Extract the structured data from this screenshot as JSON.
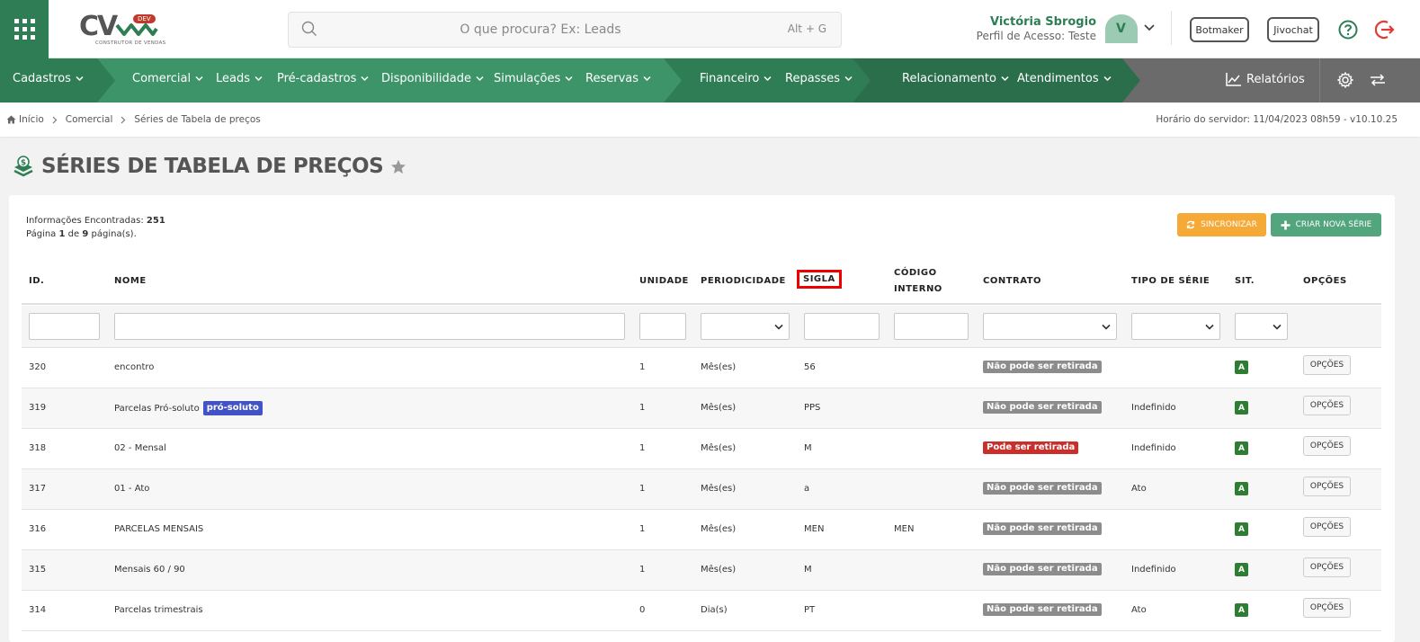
{
  "header": {
    "logo": {
      "text": "CV",
      "badge": "DEV",
      "subtitle": "CONSTRUTOR DE VENDAS"
    },
    "search": {
      "placeholder": "O que procura? Ex: Leads",
      "shortcut": "Alt + G"
    },
    "user": {
      "name": "Victória Sbrogio",
      "profile": "Perfil de Acesso: Teste",
      "avatar_initial": "V"
    },
    "buttons": {
      "botmaker": "Botmaker",
      "jivochat": "Jivochat"
    }
  },
  "nav": {
    "items": [
      {
        "label": "Cadastros"
      },
      {
        "label": "Comercial"
      },
      {
        "label": "Leads"
      },
      {
        "label": "Pré-cadastros"
      },
      {
        "label": "Disponibilidade"
      },
      {
        "label": "Simulações"
      },
      {
        "label": "Reservas"
      },
      {
        "label": "Financeiro"
      },
      {
        "label": "Repasses"
      },
      {
        "label": "Relacionamento"
      },
      {
        "label": "Atendimentos"
      }
    ],
    "reports": "Relatórios"
  },
  "breadcrumb": {
    "items": [
      "Início",
      "Comercial",
      "Séries de Tabela de preços"
    ],
    "server_time": "Horário do servidor: 11/04/2023 08h59 - v10.10.25"
  },
  "page": {
    "title": "SÉRIES DE TABELA DE PREÇOS",
    "info_label": "Informações Encontradas:",
    "info_count": "251",
    "page_prefix": "Página",
    "page_current": "1",
    "page_of": "de",
    "page_total": "9",
    "page_suffix": "página(s).",
    "sync_label": "SINCRONIZAR",
    "new_label": "CRIAR NOVA SÉRIE"
  },
  "table": {
    "headers": {
      "id": "ID.",
      "nome": "NOME",
      "unidade": "UNIDADE",
      "periodicidade": "PERIODICIDADE",
      "sigla": "SIGLA",
      "codigo_1": "CÓDIGO",
      "codigo_2": "INTERNO",
      "contrato": "CONTRATO",
      "tipo": "TIPO DE SÉRIE",
      "sit": "SIT.",
      "opcoes": "OPÇÕES"
    },
    "rows": [
      {
        "id": "320",
        "nome": "encontro",
        "tag": "",
        "unidade": "1",
        "periodicidade": "Mês(es)",
        "sigla": "56",
        "codigo": "",
        "contrato": "Não pode ser retirada",
        "contrato_type": "grey",
        "tipo": "",
        "sit": "A",
        "opcoes": "OPÇÕES"
      },
      {
        "id": "319",
        "nome": "Parcelas Pró-soluto",
        "tag": "pró-soluto",
        "unidade": "1",
        "periodicidade": "Mês(es)",
        "sigla": "PPS",
        "codigo": "",
        "contrato": "Não pode ser retirada",
        "contrato_type": "grey",
        "tipo": "Indefinido",
        "sit": "A",
        "opcoes": "OPÇÕES"
      },
      {
        "id": "318",
        "nome": "02 - Mensal",
        "tag": "",
        "unidade": "1",
        "periodicidade": "Mês(es)",
        "sigla": "M",
        "codigo": "",
        "contrato": "Pode ser retirada",
        "contrato_type": "red",
        "tipo": "Indefinido",
        "sit": "A",
        "opcoes": "OPÇÕES"
      },
      {
        "id": "317",
        "nome": "01 - Ato",
        "tag": "",
        "unidade": "1",
        "periodicidade": "Mês(es)",
        "sigla": "a",
        "codigo": "",
        "contrato": "Não pode ser retirada",
        "contrato_type": "grey",
        "tipo": "Ato",
        "sit": "A",
        "opcoes": "OPÇÕES"
      },
      {
        "id": "316",
        "nome": "PARCELAS MENSAIS",
        "tag": "",
        "unidade": "1",
        "periodicidade": "Mês(es)",
        "sigla": "MEN",
        "codigo": "MEN",
        "contrato": "Não pode ser retirada",
        "contrato_type": "grey",
        "tipo": "",
        "sit": "A",
        "opcoes": "OPÇÕES"
      },
      {
        "id": "315",
        "nome": "Mensais 60 / 90",
        "tag": "",
        "unidade": "1",
        "periodicidade": "Mês(es)",
        "sigla": "M",
        "codigo": "",
        "contrato": "Não pode ser retirada",
        "contrato_type": "grey",
        "tipo": "Indefinido",
        "sit": "A",
        "opcoes": "OPÇÕES"
      },
      {
        "id": "314",
        "nome": "Parcelas trimestrais",
        "tag": "",
        "unidade": "0",
        "periodicidade": "Dia(s)",
        "sigla": "PT",
        "codigo": "",
        "contrato": "Não pode ser retirada",
        "contrato_type": "grey",
        "tipo": "Ato",
        "sit": "A",
        "opcoes": "OPÇÕES"
      }
    ]
  },
  "colors": {
    "brand_green": "#2e7d54",
    "nav_green": "#3d9468",
    "sync_orange": "#f5a936",
    "new_green": "#52a57c",
    "badge_red": "#c9302c",
    "badge_grey": "#8c8c8c",
    "tag_blue": "#4254c5",
    "highlight_red": "#e00000"
  }
}
